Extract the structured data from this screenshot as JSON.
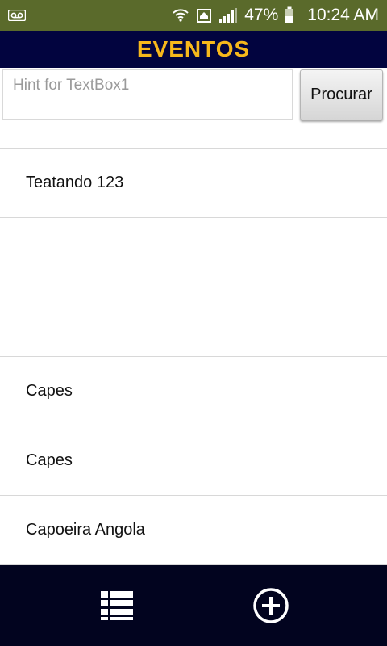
{
  "status_bar": {
    "battery_percent": "47%",
    "time": "10:24 AM",
    "icons": [
      "voicemail-icon",
      "wifi-icon",
      "home-icon",
      "signal-icon",
      "battery-icon"
    ]
  },
  "header": {
    "title": "EVENTOS",
    "colors": {
      "background": "#02043f",
      "title": "#f7b81b"
    }
  },
  "search": {
    "placeholder": "Hint for TextBox1",
    "value": "",
    "button_label": "Procurar"
  },
  "list": {
    "items": [
      {
        "label": "Teatando 123"
      },
      {
        "label": ""
      },
      {
        "label": ""
      },
      {
        "label": "Capes"
      },
      {
        "label": "Capes"
      },
      {
        "label": "Capoeira Angola"
      }
    ]
  },
  "bottom_nav": {
    "items": [
      {
        "icon": "list-icon"
      },
      {
        "icon": "add-circle-icon"
      }
    ],
    "colors": {
      "background": "#02041f"
    }
  }
}
